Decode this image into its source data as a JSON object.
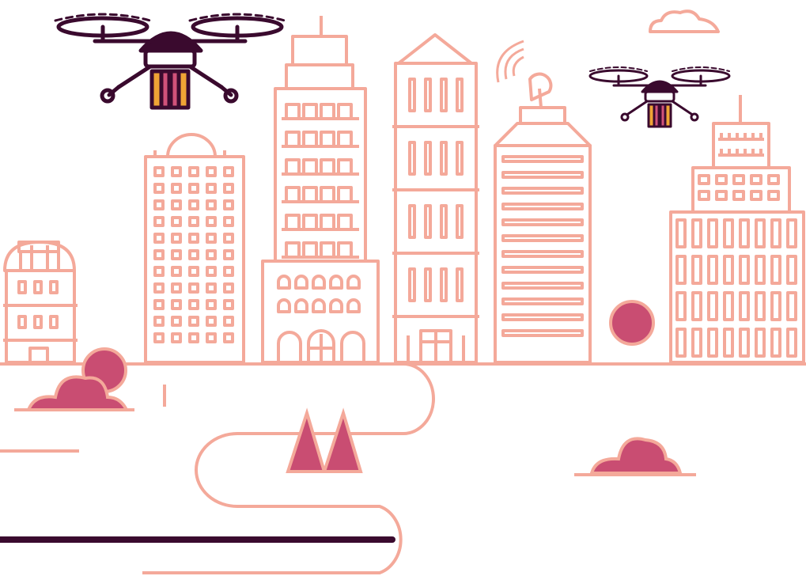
{
  "palette": {
    "background": "#ffffff",
    "outline": "#f4a99a",
    "fill_magenta": "#c94d72",
    "drone_dark": "#3a0a2e",
    "package_orange": "#f0a435",
    "package_pink": "#d1527a"
  },
  "scene": {
    "drones": [
      "drone-large",
      "drone-small"
    ],
    "buildings": [
      "domed-house",
      "apartment-block",
      "tall-tower",
      "spire-building",
      "antenna-tower",
      "office-block"
    ],
    "icons": [
      "cloud-icon",
      "satellite-dish-icon",
      "drone-icon",
      "package-icon",
      "tree-icon",
      "bush-icon"
    ]
  }
}
